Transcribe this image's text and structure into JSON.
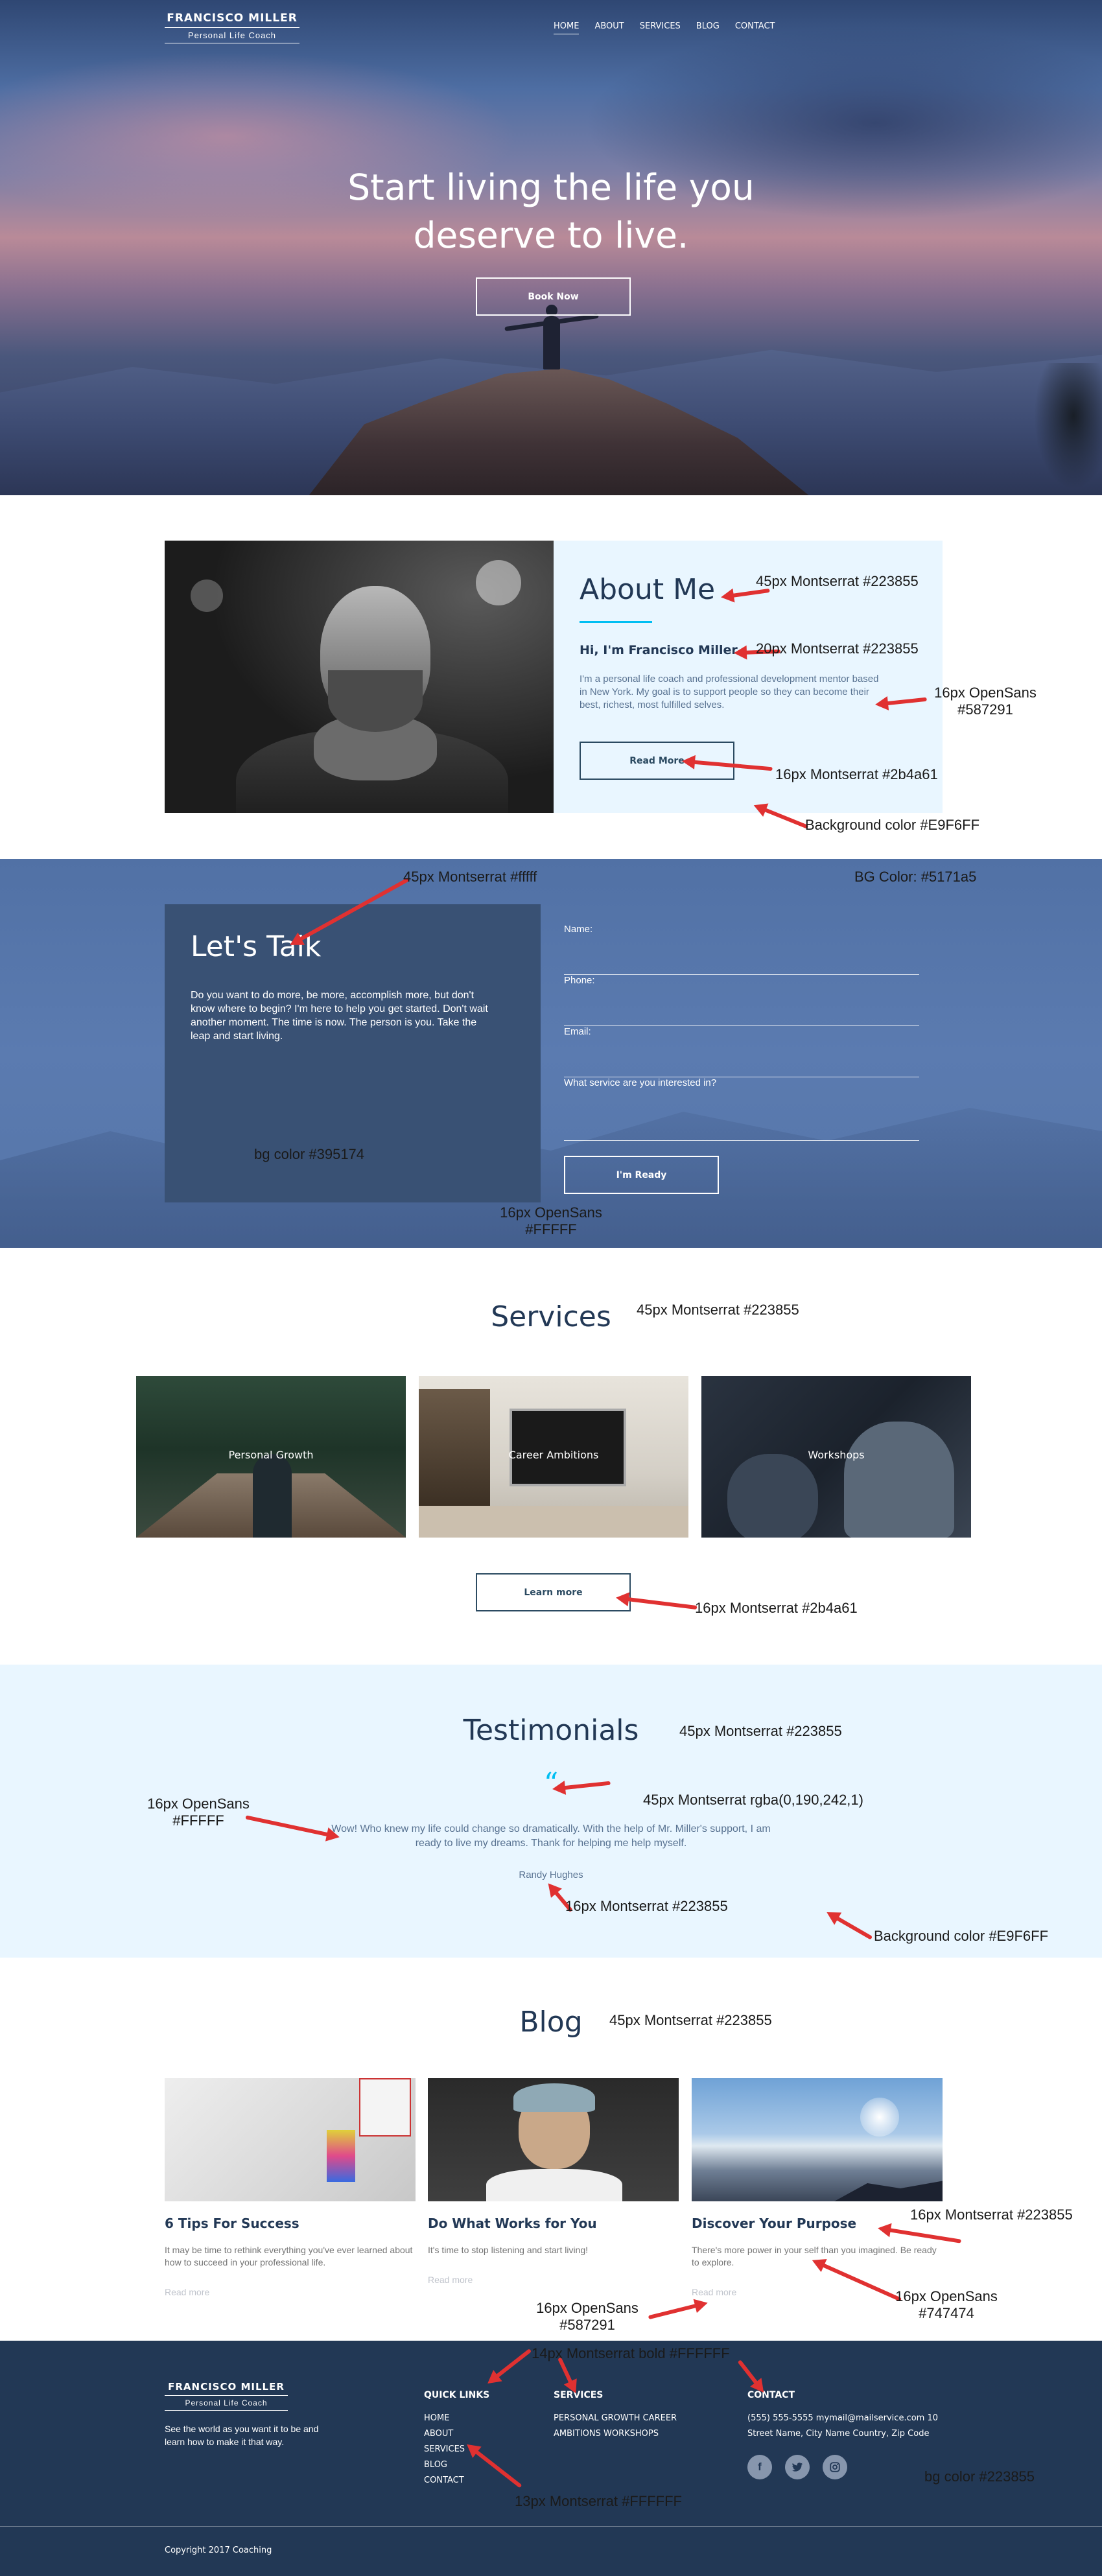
{
  "header": {
    "brand_name": "FRANCISCO MILLER",
    "brand_tagline": "Personal Life Coach",
    "nav": [
      "HOME",
      "ABOUT",
      "SERVICES",
      "BLOG",
      "CONTACT"
    ],
    "active_nav": "HOME"
  },
  "hero": {
    "title_line1": "Start living the life you",
    "title_line2": "deserve to live.",
    "cta_label": "Book Now"
  },
  "about": {
    "title": "About Me",
    "greeting": "Hi, I'm Francisco Miller.",
    "text": "I'm a personal life coach and professional development mentor based in New York. My goal is to support people so they can become their best, richest, most fulfilled selves.",
    "button_label": "Read More"
  },
  "contact": {
    "title": "Let's Talk",
    "text": "Do you want to do more, be more, accomplish more, but don't know where to begin? I'm here to help you get started. Don't wait another moment. The time is now. The person is you. Take the leap and start living.",
    "fields": {
      "name_label": "Name:",
      "phone_label": "Phone:",
      "email_label": "Email:",
      "service_label": "What service are you interested in?"
    },
    "button_label": "I'm Ready"
  },
  "services": {
    "title": "Services",
    "items": [
      "Personal Growth",
      "Career Ambitions",
      "Workshops"
    ],
    "button_label": "Learn more"
  },
  "testimonials": {
    "title": "Testimonials",
    "quote_mark": "“",
    "text": "Wow! Who knew my life could change so dramatically. With the help of Mr. Miller's support, I am ready to live my dreams. Thank for helping me help myself.",
    "author": "Randy Hughes"
  },
  "blog": {
    "title": "Blog",
    "posts": [
      {
        "title": "6 Tips For Success",
        "excerpt": "It may be time to rethink everything you've ever learned about how to succeed in your professional life.",
        "more": "Read more"
      },
      {
        "title": "Do What Works for You",
        "excerpt": "It's time to stop listening and start living!",
        "more": "Read more"
      },
      {
        "title": "Discover Your Purpose",
        "excerpt": "There's more power in your self than you imagined. Be ready to explore.",
        "more": "Read more"
      }
    ]
  },
  "footer": {
    "brand_name": "FRANCISCO MILLER",
    "brand_tagline": "Personal Life Coach",
    "about": "See the world as you want it to be and learn how to make it that way.",
    "quick_links_title": "QUICK LINKS",
    "quick_links": [
      "HOME",
      "ABOUT",
      "SERVICES",
      "BLOG",
      "CONTACT"
    ],
    "services_title": "SERVICES",
    "services_line1": "PERSONAL GROWTH  CAREER",
    "services_line2": "AMBITIONS WORKSHOPS",
    "contact_title": "CONTACT",
    "contact_line1": "(555) 555-5555 mymail@mailservice.com 10",
    "contact_line2": "Street Name, City Name Country, Zip Code",
    "social": [
      "facebook-icon",
      "twitter-icon",
      "instagram-icon"
    ],
    "copyright": "Copyright 2017 Coaching"
  },
  "annotations": {
    "about_title": "45px Montserrat #223855",
    "about_hi": "20px Montserrat #223855",
    "about_text_1": "16px OpenSans",
    "about_text_2": "#587291",
    "about_btn": "16px Montserrat #2b4a61",
    "about_bg": "Background color #E9F6FF",
    "talk_title": "45px Montserrat #fffff",
    "talk_bg": "BG Color: #5171a5",
    "talk_box_bg": "bg color #395174",
    "talk_text_1": "16px OpenSans",
    "talk_text_2": "#FFFFF",
    "services_title": "45px Montserrat #223855",
    "services_btn": "16px Montserrat #2b4a61",
    "testi_title": "45px Montserrat #223855",
    "testi_quote": "45px Montserrat rgba(0,190,242,1)",
    "testi_text_1": "16px OpenSans",
    "testi_text_2": "#FFFFF",
    "testi_name": "16px Montserrat #223855",
    "testi_bg": "Background color #E9F6FF",
    "blog_title": "45px Montserrat #223855",
    "blog_post_title": "16px Montserrat #223855",
    "blog_excerpt_1": "16px OpenSans",
    "blog_excerpt_2": "#747474",
    "blog_more_1": "16px OpenSans",
    "blog_more_2": "#587291",
    "footer_head": "14px Montserrat bold #FFFFFF",
    "footer_link": "13px Montserrat #FFFFFF",
    "footer_bg": "bg color #223855"
  },
  "colors": {
    "navy": "#223855",
    "light_bg": "#E9F6FF",
    "talk_bg": "#5171a5",
    "talk_box": "#395174",
    "accent": "#00bef2",
    "annotation_arrow": "#e03131"
  }
}
